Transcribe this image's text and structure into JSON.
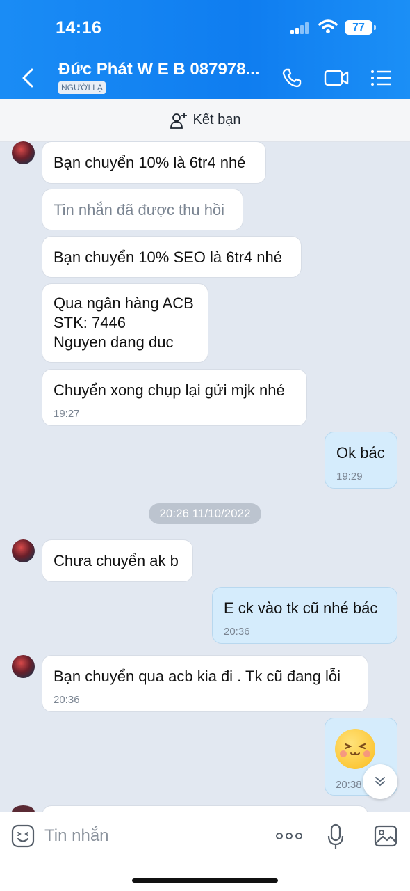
{
  "status_bar": {
    "time": "14:16",
    "battery": "77"
  },
  "header": {
    "contact_name": "Đức Phát W E B 087978...",
    "badge": "NGƯỜI LẠ"
  },
  "friend_bar": {
    "label": "Kết bạn"
  },
  "date_separator": "20:26 11/10/2022",
  "messages": [
    {
      "text": "Bạn chuyển 10% là 6tr4 nhé",
      "time": ""
    },
    {
      "text": "Tin nhắn đã được thu hồi",
      "time": ""
    },
    {
      "text": "Bạn chuyển 10% SEO là 6tr4 nhé",
      "time": ""
    },
    {
      "lines": [
        "Qua ngân hàng ACB",
        "STK: 7446",
        "Nguyen dang duc"
      ],
      "time": ""
    },
    {
      "text": "Chuyển xong chụp lại gửi mjk nhé",
      "time": "19:27"
    },
    {
      "text": "Ok bác",
      "time": "19:29"
    },
    {
      "text": "Chưa chuyển ak b",
      "time": ""
    },
    {
      "text": "E ck vào tk cũ nhé bác",
      "time": "20:36"
    },
    {
      "text": "Bạn chuyển qua acb kia đi . Tk cũ đang lỗi",
      "time": "20:36"
    },
    {
      "emoji": "smiling-face-sticker",
      "time": "20:38"
    }
  ],
  "composer": {
    "placeholder": "Tin nhắn"
  },
  "colors": {
    "header_blue": "#1a8cf5",
    "sent_bubble": "#d5ecfc",
    "received_bubble": "#ffffff",
    "chat_bg": "#e2e8f1"
  }
}
